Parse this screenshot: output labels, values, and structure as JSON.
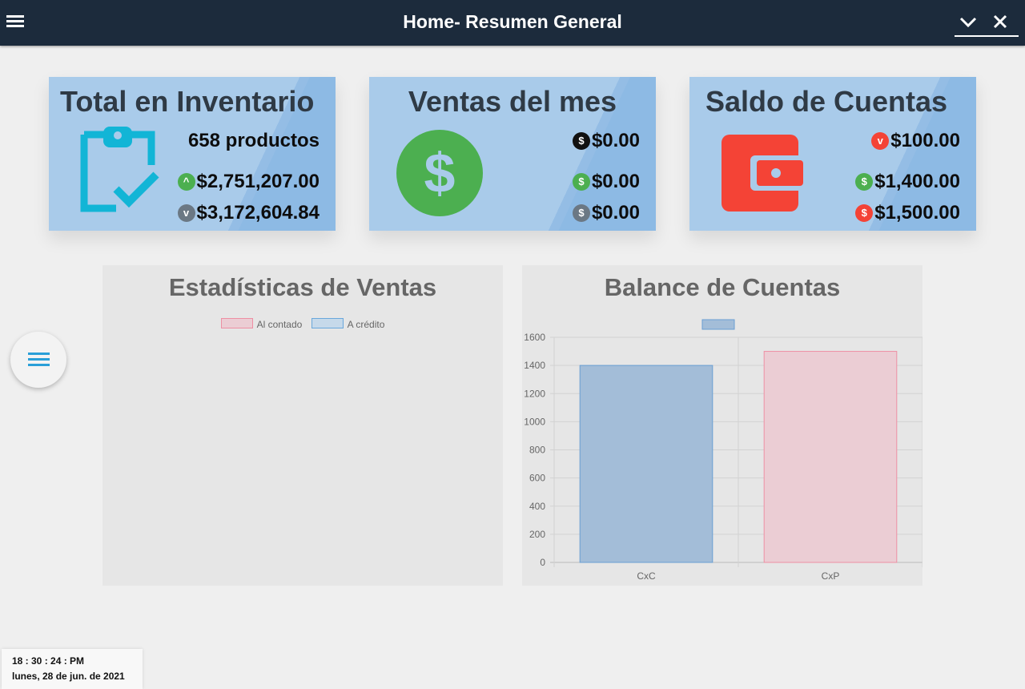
{
  "header": {
    "title": "Home- Resumen General"
  },
  "cards": {
    "inventario": {
      "title": "Total en Inventario",
      "productos": "658 productos",
      "value_up": "$2,751,207.00",
      "value_down": "$3,172,604.84"
    },
    "ventas": {
      "title": "Ventas del mes",
      "value_1": "$0.00",
      "value_2": "$0.00",
      "value_3": "$0.00"
    },
    "saldo": {
      "title": "Saldo de Cuentas",
      "value_1": "$100.00",
      "value_2": "$1,400.00",
      "value_3": "$1,500.00"
    }
  },
  "stats_chart": {
    "title": "Estadísticas de Ventas",
    "legend": [
      "Al contado",
      "A crédito"
    ]
  },
  "colors": {
    "topbar": "#1c2b3c",
    "card_bg": "#a9cbea",
    "clipboard_icon": "#12b5d6",
    "dollar_green": "#4caf50",
    "wallet_red": "#f44336",
    "bar_cxc": "#a3bdd8",
    "bar_cxp": "#ebcdd4"
  },
  "chart_data": {
    "type": "bar",
    "title": "Balance de Cuentas",
    "categories": [
      "CxC",
      "CxP"
    ],
    "values": [
      1400,
      1500
    ],
    "ylim": [
      0,
      1600
    ],
    "yticks": [
      0,
      200,
      400,
      600,
      800,
      1000,
      1200,
      1400,
      1600
    ],
    "grid": true,
    "legend": "top-center"
  },
  "clock": {
    "time": "18 : 30 : 24 : PM",
    "date": "lunes, 28 de jun. de 2021"
  }
}
